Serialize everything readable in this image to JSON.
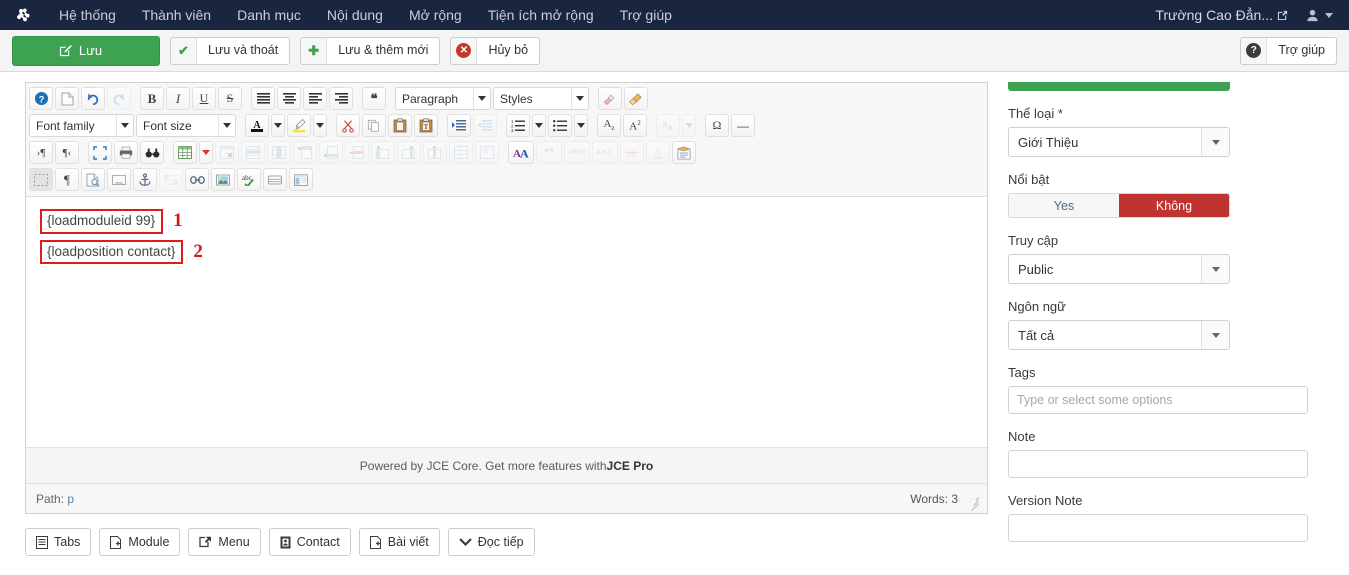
{
  "topbar": {
    "logo_icon": "joomla-logo-icon",
    "menu": [
      {
        "label": "Hệ thống"
      },
      {
        "label": "Thành viên"
      },
      {
        "label": "Danh mục"
      },
      {
        "label": "Nội dung"
      },
      {
        "label": "Mở rộng"
      },
      {
        "label": "Tiện ích mở rộng"
      },
      {
        "label": "Trợ giúp"
      }
    ],
    "site_name": "Trường Cao Đẳn...",
    "preview_icon": "external-link-icon",
    "user_icon": "user-icon",
    "caret_icon": "chevron-down-icon"
  },
  "toolbar": {
    "save": "Lưu",
    "save_close": "Lưu và thoát",
    "save_new": "Lưu & thêm mới",
    "cancel": "Hủy bỏ",
    "help": "Trợ giúp"
  },
  "editor": {
    "row1": [
      {
        "name": "editor-help-icon",
        "glyph": "?"
      },
      {
        "name": "new-document-icon",
        "glyph": "📄"
      },
      {
        "name": "undo-icon",
        "glyph": "↺"
      },
      {
        "name": "redo-icon",
        "glyph": "↻",
        "disabled": true
      },
      {
        "name": "bold-icon",
        "glyph": "B"
      },
      {
        "name": "italic-icon",
        "glyph": "I"
      },
      {
        "name": "underline-icon",
        "glyph": "U"
      },
      {
        "name": "strikethrough-icon",
        "glyph": "S"
      },
      {
        "name": "align-justify-icon",
        "glyph": "≣"
      },
      {
        "name": "align-center-icon",
        "glyph": "≣"
      },
      {
        "name": "align-left-icon",
        "glyph": "≣"
      },
      {
        "name": "align-right-icon",
        "glyph": "≣"
      },
      {
        "name": "blockquote-icon",
        "glyph": "❝"
      }
    ],
    "font_family": "Font family",
    "font_size": "Font size",
    "paragraph": "Paragraph",
    "styles": "Styles",
    "row1_tail": [
      {
        "name": "remove-format-icon",
        "glyph": "🖊"
      },
      {
        "name": "clean-styles-icon",
        "glyph": "🧹"
      }
    ],
    "row2": [
      {
        "name": "text-color-icon",
        "glyph": "A"
      },
      {
        "name": "highlight-color-icon",
        "glyph": "✎"
      },
      {
        "name": "cut-icon",
        "glyph": "✂"
      },
      {
        "name": "copy-icon",
        "glyph": "⧉"
      },
      {
        "name": "paste-icon",
        "glyph": "📋"
      },
      {
        "name": "paste-text-icon",
        "glyph": "📋"
      },
      {
        "name": "indent-icon",
        "glyph": "⇥"
      },
      {
        "name": "outdent-icon",
        "glyph": "⇤",
        "disabled": true
      },
      {
        "name": "numbered-list-icon",
        "glyph": "1≡"
      },
      {
        "name": "bullet-list-icon",
        "glyph": "•≡"
      },
      {
        "name": "subscript-icon",
        "glyph": "A₂"
      },
      {
        "name": "superscript-icon",
        "glyph": "A²"
      },
      {
        "name": "spellcheck-text-icon",
        "glyph": "a",
        "disabled": true
      },
      {
        "name": "special-character-icon",
        "glyph": "Ω"
      },
      {
        "name": "horizontal-rule-icon",
        "glyph": "—"
      }
    ],
    "row3": [
      {
        "name": "ltr-direction-icon",
        "glyph": "¶"
      },
      {
        "name": "rtl-direction-icon",
        "glyph": "¶"
      },
      {
        "name": "fullscreen-icon",
        "glyph": "⛶"
      },
      {
        "name": "print-icon",
        "glyph": "🖶"
      },
      {
        "name": "preview-icon",
        "glyph": "👓"
      },
      {
        "name": "insert-table-icon",
        "glyph": "▦"
      },
      {
        "name": "delete-table-icon",
        "glyph": "▦",
        "disabled": true
      },
      {
        "name": "table-row-properties-icon",
        "glyph": "▤",
        "disabled": true
      },
      {
        "name": "table-cell-properties-icon",
        "glyph": "▥",
        "disabled": true
      },
      {
        "name": "insert-row-before-icon",
        "glyph": "▤",
        "disabled": true
      },
      {
        "name": "insert-row-after-icon",
        "glyph": "▤",
        "disabled": true
      },
      {
        "name": "delete-row-icon",
        "glyph": "▤",
        "disabled": true
      },
      {
        "name": "insert-column-before-icon",
        "glyph": "▥",
        "disabled": true
      },
      {
        "name": "insert-column-after-icon",
        "glyph": "▥",
        "disabled": true
      },
      {
        "name": "delete-column-icon",
        "glyph": "▥",
        "disabled": true
      },
      {
        "name": "split-cells-icon",
        "glyph": "▦",
        "disabled": true
      },
      {
        "name": "merge-cells-icon",
        "glyph": "▣",
        "disabled": true
      },
      {
        "name": "font-case-icon",
        "glyph": "AA"
      },
      {
        "name": "quote-icon",
        "glyph": "❝❞",
        "disabled": true
      },
      {
        "name": "abbreviation-icon",
        "glyph": "ABBR",
        "disabled": true
      },
      {
        "name": "acronym-icon",
        "glyph": "A.B.C.",
        "disabled": true
      },
      {
        "name": "delete-text-icon",
        "glyph": "A",
        "disabled": true
      },
      {
        "name": "insert-text-icon",
        "glyph": "A",
        "disabled": true
      },
      {
        "name": "article-notes-icon",
        "glyph": "🗒"
      }
    ],
    "row4": [
      {
        "name": "visual-blocks-icon",
        "glyph": "⬚",
        "active": true
      },
      {
        "name": "visual-characters-icon",
        "glyph": "¶"
      },
      {
        "name": "source-code-icon",
        "glyph": "🗎"
      },
      {
        "name": "insert-page-break-icon",
        "glyph": "⎵"
      },
      {
        "name": "anchor-icon",
        "glyph": "⚓"
      },
      {
        "name": "unlink-icon",
        "glyph": "⛓",
        "disabled": true
      },
      {
        "name": "link-icon",
        "glyph": "🔗"
      },
      {
        "name": "insert-image-icon",
        "glyph": "🖼"
      },
      {
        "name": "spellchecker-icon",
        "glyph": "abc"
      },
      {
        "name": "insert-media-icon",
        "glyph": "▭"
      },
      {
        "name": "template-icon",
        "glyph": "▣"
      }
    ],
    "content": [
      {
        "text": "{loadmoduleid 99}",
        "marker": "1"
      },
      {
        "text": "{loadposition contact}",
        "marker": "2"
      }
    ],
    "footer_text": "Powered by JCE Core. Get more features with ",
    "footer_link": "JCE Pro",
    "path_label": "Path:",
    "path_value": "p",
    "word_count": "Words: 3",
    "resize_handle": "resize-grip-icon"
  },
  "xtd_buttons": [
    {
      "label": "Tabs",
      "icon": "tabs-icon"
    },
    {
      "label": "Module",
      "icon": "module-icon"
    },
    {
      "label": "Menu",
      "icon": "menu-icon"
    },
    {
      "label": "Contact",
      "icon": "contact-icon"
    },
    {
      "label": "Bài viết",
      "icon": "article-icon"
    },
    {
      "label": "Đọc tiếp",
      "icon": "readmore-icon"
    }
  ],
  "sidebar": {
    "category": {
      "label": "Thể loại *",
      "value": "Giới Thiệu"
    },
    "featured": {
      "label": "Nổi bật",
      "yes": "Yes",
      "no": "Không",
      "selected": "Không"
    },
    "access": {
      "label": "Truy cập",
      "value": "Public"
    },
    "language": {
      "label": "Ngôn ngữ",
      "value": "Tất cả"
    },
    "tags": {
      "label": "Tags",
      "placeholder": "Type or select some options",
      "value": ""
    },
    "note": {
      "label": "Note",
      "value": ""
    },
    "version_note": {
      "label": "Version Note",
      "value": ""
    }
  },
  "colors": {
    "topbar_bg": "#1a2640",
    "save_green": "#3ea351",
    "danger_red": "#bf3430",
    "marker_red": "#e11b1b"
  }
}
